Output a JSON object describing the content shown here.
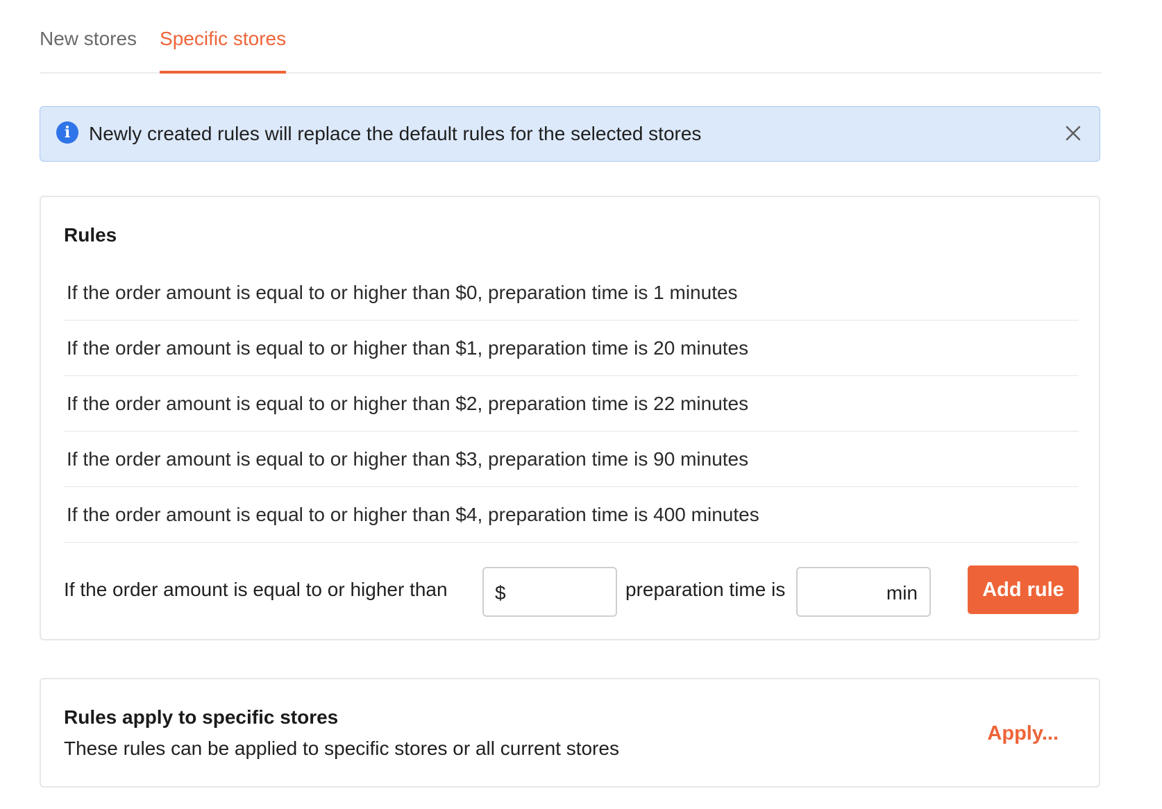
{
  "tabs": [
    {
      "label": "New stores",
      "active": false
    },
    {
      "label": "Specific stores",
      "active": true
    }
  ],
  "alert": {
    "icon": "info-icon",
    "text": "Newly created rules will replace the default rules for the selected stores",
    "close_icon": "close-icon"
  },
  "rules_card": {
    "title": "Rules",
    "rules": [
      "If the order amount is equal to or higher than $0, preparation time is 1 minutes",
      "If the order amount is equal to or higher than $1, preparation time is 20 minutes",
      "If the order amount is equal to or higher than $2, preparation time is 22 minutes",
      "If the order amount is equal to or higher than $3, preparation time is 90 minutes",
      "If the order amount is equal to or higher than $4, preparation time is 400 minutes"
    ],
    "add_rule": {
      "amount_label": "If the order amount is equal to or higher than",
      "amount_prefix": "$",
      "amount_value": "",
      "time_label": "preparation time is",
      "time_value": "",
      "time_suffix": "min",
      "button_label": "Add rule"
    }
  },
  "apply_card": {
    "title": "Rules apply to specific stores",
    "description": "These rules can be applied to specific stores or all current stores",
    "link_label": "Apply..."
  },
  "colors": {
    "accent": "#ee6438",
    "info_bg": "#dce9fb",
    "info_icon": "#2f74e8"
  }
}
